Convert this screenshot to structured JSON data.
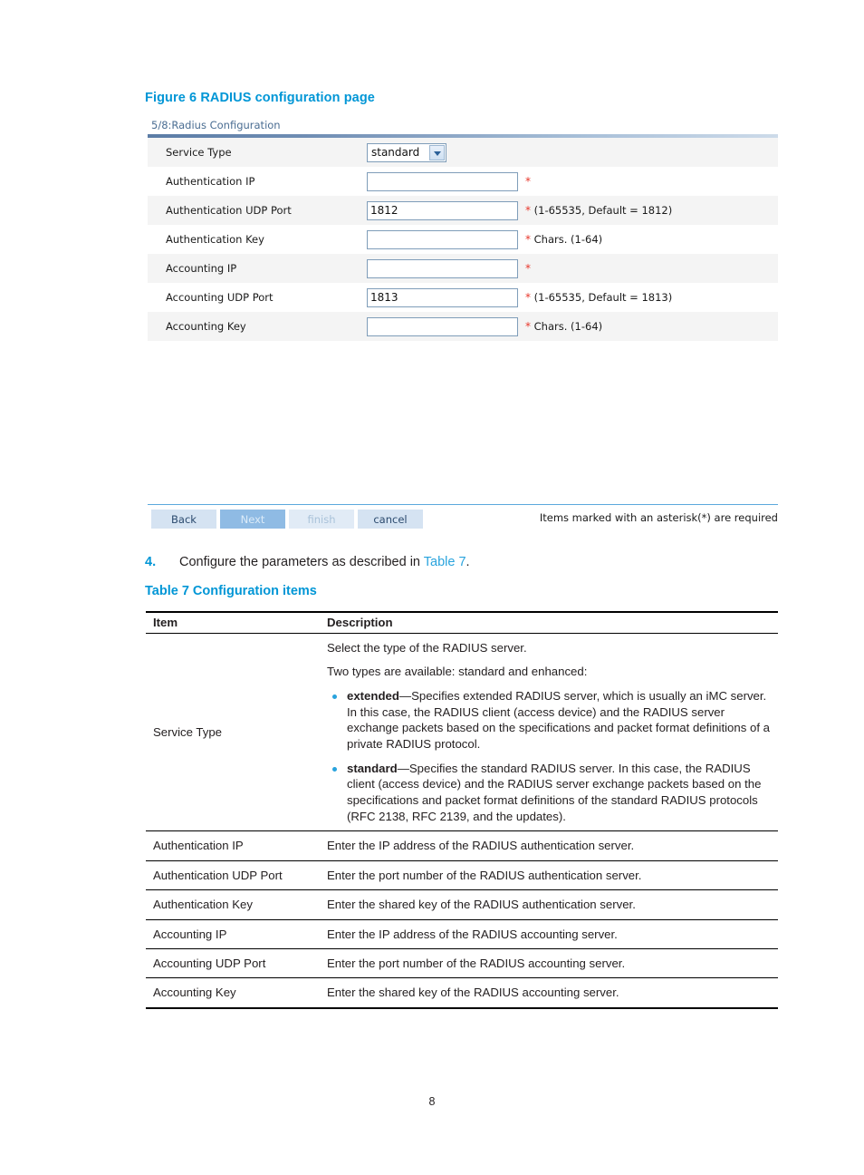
{
  "figure": {
    "caption": "Figure 6 RADIUS configuration page"
  },
  "screenshot": {
    "panel_title": "5/8:Radius Configuration",
    "rows": [
      {
        "label": "Service Type",
        "control": "select",
        "value": "standard",
        "hint_star": "",
        "hint_text": ""
      },
      {
        "label": "Authentication IP",
        "control": "text",
        "value": "",
        "hint_star": "*",
        "hint_text": ""
      },
      {
        "label": "Authentication UDP Port",
        "control": "text",
        "value": "1812",
        "hint_star": "*",
        "hint_text": " (1-65535, Default = 1812)"
      },
      {
        "label": "Authentication Key",
        "control": "text",
        "value": "",
        "hint_star": "*",
        "hint_text": " Chars. (1-64)"
      },
      {
        "label": "Accounting IP",
        "control": "text",
        "value": "",
        "hint_star": "*",
        "hint_text": ""
      },
      {
        "label": "Accounting UDP Port",
        "control": "text",
        "value": "1813",
        "hint_star": "*",
        "hint_text": " (1-65535, Default = 1813)"
      },
      {
        "label": "Accounting Key",
        "control": "text",
        "value": "",
        "hint_star": "*",
        "hint_text": " Chars. (1-64)"
      }
    ],
    "buttons": {
      "back": "Back",
      "next": "Next",
      "finish": "finish",
      "cancel": "cancel"
    },
    "required_note": "Items marked with an asterisk(*) are required"
  },
  "step": {
    "number": "4.",
    "text_before": "Configure the parameters as described in ",
    "xref": "Table 7",
    "text_after": "."
  },
  "table_caption": "Table 7 Configuration items",
  "config_table": {
    "headers": {
      "item": "Item",
      "description": "Description"
    },
    "service_type": {
      "item": "Service Type",
      "line1": "Select the type of the RADIUS server.",
      "line2": "Two types are available: standard and enhanced:",
      "bullet1_bold": "extended",
      "bullet1_text": "—Specifies extended RADIUS server, which is usually an iMC server. In this case, the RADIUS client (access device) and the RADIUS server exchange packets based on the specifications and packet format definitions of a private RADIUS protocol.",
      "bullet2_bold": "standard",
      "bullet2_text": "—Specifies the standard RADIUS server. In this case, the RADIUS client (access device) and the RADIUS server exchange packets based on the specifications and packet format definitions of the standard RADIUS protocols (RFC 2138, RFC 2139, and the updates)."
    },
    "rows": [
      {
        "item": "Authentication IP",
        "description": "Enter the IP address of the RADIUS authentication server."
      },
      {
        "item": "Authentication UDP Port",
        "description": "Enter the port number of the RADIUS authentication server."
      },
      {
        "item": "Authentication Key",
        "description": "Enter the shared key of the RADIUS authentication server."
      },
      {
        "item": "Accounting IP",
        "description": "Enter the IP address of the RADIUS accounting server."
      },
      {
        "item": "Accounting UDP Port",
        "description": "Enter the port number of the RADIUS accounting server."
      },
      {
        "item": "Accounting Key",
        "description": "Enter the shared key of the RADIUS accounting server."
      }
    ]
  },
  "page_number": "8",
  "colors": {
    "heading_blue": "#0096d6",
    "link_blue": "#29a3dd",
    "required_red": "#e8372b",
    "panel_title_blue": "#4a6d92"
  }
}
